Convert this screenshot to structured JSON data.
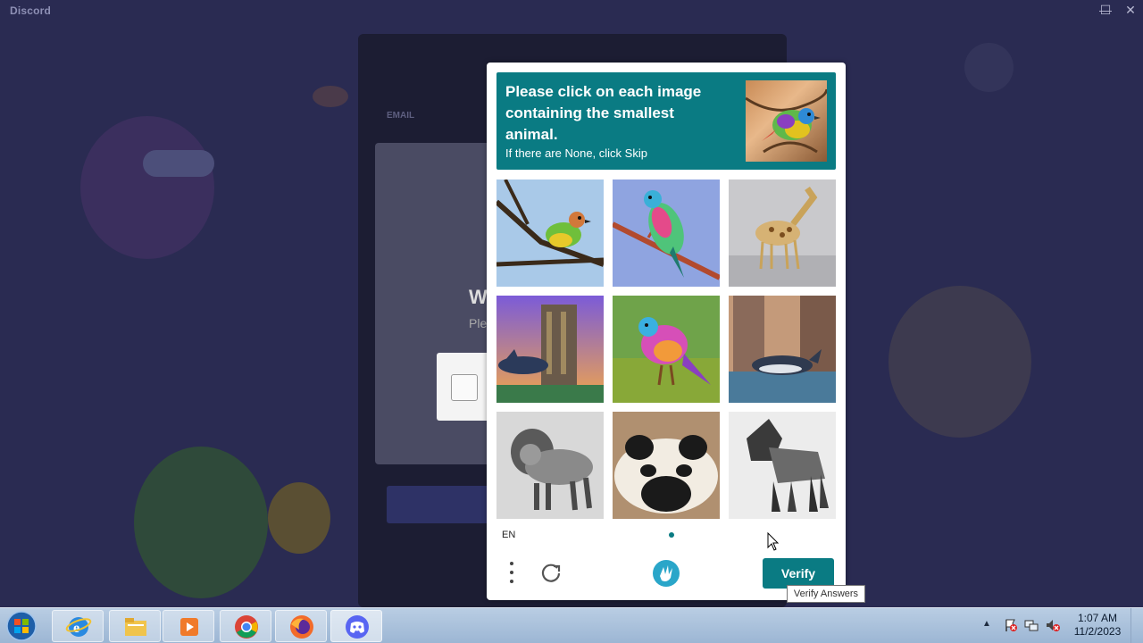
{
  "window": {
    "app_title": "Discord",
    "minimize_glyph": "—",
    "maximize_glyph": "☐",
    "close_glyph": "✕"
  },
  "login": {
    "field_label": "EMAIL",
    "heading": "W",
    "subtext": "Ple"
  },
  "captcha": {
    "prompt_title": "Please click on each image containing the smallest animal.",
    "prompt_subtitle": "If there are None, click Skip",
    "tiles": [
      {
        "name": "bird-on-branch-blue"
      },
      {
        "name": "rainbow-bird"
      },
      {
        "name": "giraffe"
      },
      {
        "name": "dolphin-city-sunset"
      },
      {
        "name": "colorful-bird"
      },
      {
        "name": "dolphin-city"
      },
      {
        "name": "lion-gray"
      },
      {
        "name": "panda"
      },
      {
        "name": "lion-polygon"
      }
    ],
    "language": "EN",
    "verify_label": "Verify",
    "tooltip": "Verify Answers",
    "accent_color": "#0a7b83"
  },
  "taskbar": {
    "items": [
      "internet-explorer",
      "file-explorer",
      "media-player",
      "chrome",
      "firefox",
      "discord"
    ],
    "clock_time": "1:07 AM",
    "clock_date": "11/2/2023"
  }
}
